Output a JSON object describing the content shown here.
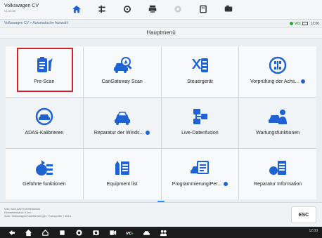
{
  "header": {
    "vehicle_name": "Volkswagen CV",
    "vehicle_sub": "V1.00.00",
    "toolbar_icons": [
      "home-icon",
      "tools-icon",
      "gear-icon",
      "print-icon",
      "help-icon",
      "data-icon",
      "camera-icon"
    ]
  },
  "breadcrumb": "Volkswagen CV > Automatische Auswahl",
  "status": {
    "vci_label": "VCI",
    "time": "12:00"
  },
  "menu_title": "Hauptmenü",
  "tiles": [
    {
      "label": "Pre-Scan",
      "icon": "clipboard-wrench-icon",
      "info": false
    },
    {
      "label": "CanGateway Scan",
      "icon": "car-scan-icon",
      "info": false
    },
    {
      "label": "Steuergerät",
      "icon": "ecu-list-icon",
      "info": false
    },
    {
      "label": "Vorprüfung der Achs...",
      "icon": "axle-check-icon",
      "info": true
    },
    {
      "label": "ADAS-Kalibrieren",
      "icon": "adas-icon",
      "info": false
    },
    {
      "label": "Reparatur der Winds...",
      "icon": "windshield-repair-icon",
      "info": true
    },
    {
      "label": "Live-Datenfusion",
      "icon": "live-data-icon",
      "info": false
    },
    {
      "label": "Wartungsfunktionen",
      "icon": "maintenance-icon",
      "info": false
    },
    {
      "label": "Geführte funktionen",
      "icon": "guided-functions-icon",
      "info": false
    },
    {
      "label": "Equipment list",
      "icon": "equipment-list-icon",
      "info": false
    },
    {
      "label": "Programmierung/Per...",
      "icon": "programming-icon",
      "info": true
    },
    {
      "label": "Reparatur Information",
      "icon": "repair-info-icon",
      "info": false
    }
  ],
  "selected_tile": "Pre-Scan",
  "bottom": {
    "info_line1": "VIN: WV1ZZZ7HZ0H000000",
    "info_line2": "Kilometerstand: 0 km",
    "info_line3": "Auto: Volkswagen Nutzfahrzeuge / Transporter / 2014",
    "esc_label": "ESC"
  },
  "navbar": {
    "icons": [
      "back-icon",
      "home-icon",
      "house-icon",
      "recent-apps-icon",
      "browser-icon",
      "gallery-icon",
      "screen-record-icon",
      "vci-icon",
      "car-icon",
      "people-icon"
    ],
    "status_text": "12:00"
  },
  "colors": {
    "accent_blue": "#1f62d4",
    "selected_red": "#d6222a",
    "vci_green": "#2aa63a"
  }
}
